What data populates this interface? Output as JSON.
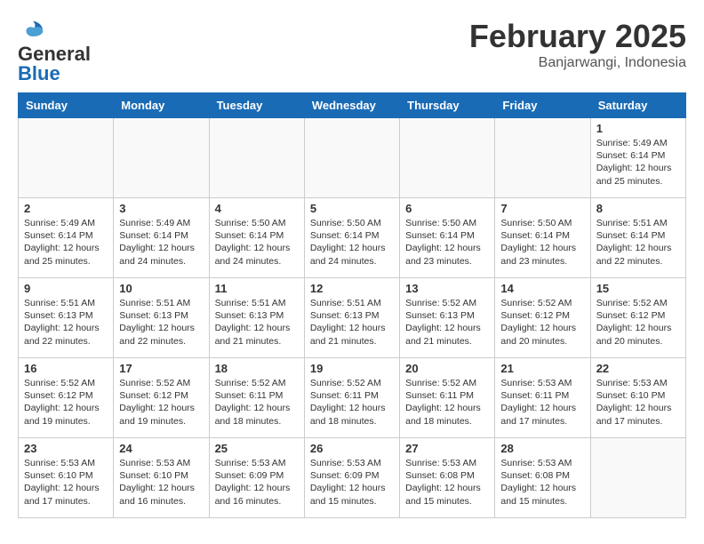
{
  "header": {
    "logo_general": "General",
    "logo_blue": "Blue",
    "month_year": "February 2025",
    "location": "Banjarwangi, Indonesia"
  },
  "days_of_week": [
    "Sunday",
    "Monday",
    "Tuesday",
    "Wednesday",
    "Thursday",
    "Friday",
    "Saturday"
  ],
  "weeks": [
    [
      {
        "day": "",
        "info": ""
      },
      {
        "day": "",
        "info": ""
      },
      {
        "day": "",
        "info": ""
      },
      {
        "day": "",
        "info": ""
      },
      {
        "day": "",
        "info": ""
      },
      {
        "day": "",
        "info": ""
      },
      {
        "day": "1",
        "info": "Sunrise: 5:49 AM\nSunset: 6:14 PM\nDaylight: 12 hours\nand 25 minutes."
      }
    ],
    [
      {
        "day": "2",
        "info": "Sunrise: 5:49 AM\nSunset: 6:14 PM\nDaylight: 12 hours\nand 25 minutes."
      },
      {
        "day": "3",
        "info": "Sunrise: 5:49 AM\nSunset: 6:14 PM\nDaylight: 12 hours\nand 24 minutes."
      },
      {
        "day": "4",
        "info": "Sunrise: 5:50 AM\nSunset: 6:14 PM\nDaylight: 12 hours\nand 24 minutes."
      },
      {
        "day": "5",
        "info": "Sunrise: 5:50 AM\nSunset: 6:14 PM\nDaylight: 12 hours\nand 24 minutes."
      },
      {
        "day": "6",
        "info": "Sunrise: 5:50 AM\nSunset: 6:14 PM\nDaylight: 12 hours\nand 23 minutes."
      },
      {
        "day": "7",
        "info": "Sunrise: 5:50 AM\nSunset: 6:14 PM\nDaylight: 12 hours\nand 23 minutes."
      },
      {
        "day": "8",
        "info": "Sunrise: 5:51 AM\nSunset: 6:14 PM\nDaylight: 12 hours\nand 22 minutes."
      }
    ],
    [
      {
        "day": "9",
        "info": "Sunrise: 5:51 AM\nSunset: 6:13 PM\nDaylight: 12 hours\nand 22 minutes."
      },
      {
        "day": "10",
        "info": "Sunrise: 5:51 AM\nSunset: 6:13 PM\nDaylight: 12 hours\nand 22 minutes."
      },
      {
        "day": "11",
        "info": "Sunrise: 5:51 AM\nSunset: 6:13 PM\nDaylight: 12 hours\nand 21 minutes."
      },
      {
        "day": "12",
        "info": "Sunrise: 5:51 AM\nSunset: 6:13 PM\nDaylight: 12 hours\nand 21 minutes."
      },
      {
        "day": "13",
        "info": "Sunrise: 5:52 AM\nSunset: 6:13 PM\nDaylight: 12 hours\nand 21 minutes."
      },
      {
        "day": "14",
        "info": "Sunrise: 5:52 AM\nSunset: 6:12 PM\nDaylight: 12 hours\nand 20 minutes."
      },
      {
        "day": "15",
        "info": "Sunrise: 5:52 AM\nSunset: 6:12 PM\nDaylight: 12 hours\nand 20 minutes."
      }
    ],
    [
      {
        "day": "16",
        "info": "Sunrise: 5:52 AM\nSunset: 6:12 PM\nDaylight: 12 hours\nand 19 minutes."
      },
      {
        "day": "17",
        "info": "Sunrise: 5:52 AM\nSunset: 6:12 PM\nDaylight: 12 hours\nand 19 minutes."
      },
      {
        "day": "18",
        "info": "Sunrise: 5:52 AM\nSunset: 6:11 PM\nDaylight: 12 hours\nand 18 minutes."
      },
      {
        "day": "19",
        "info": "Sunrise: 5:52 AM\nSunset: 6:11 PM\nDaylight: 12 hours\nand 18 minutes."
      },
      {
        "day": "20",
        "info": "Sunrise: 5:52 AM\nSunset: 6:11 PM\nDaylight: 12 hours\nand 18 minutes."
      },
      {
        "day": "21",
        "info": "Sunrise: 5:53 AM\nSunset: 6:11 PM\nDaylight: 12 hours\nand 17 minutes."
      },
      {
        "day": "22",
        "info": "Sunrise: 5:53 AM\nSunset: 6:10 PM\nDaylight: 12 hours\nand 17 minutes."
      }
    ],
    [
      {
        "day": "23",
        "info": "Sunrise: 5:53 AM\nSunset: 6:10 PM\nDaylight: 12 hours\nand 17 minutes."
      },
      {
        "day": "24",
        "info": "Sunrise: 5:53 AM\nSunset: 6:10 PM\nDaylight: 12 hours\nand 16 minutes."
      },
      {
        "day": "25",
        "info": "Sunrise: 5:53 AM\nSunset: 6:09 PM\nDaylight: 12 hours\nand 16 minutes."
      },
      {
        "day": "26",
        "info": "Sunrise: 5:53 AM\nSunset: 6:09 PM\nDaylight: 12 hours\nand 15 minutes."
      },
      {
        "day": "27",
        "info": "Sunrise: 5:53 AM\nSunset: 6:08 PM\nDaylight: 12 hours\nand 15 minutes."
      },
      {
        "day": "28",
        "info": "Sunrise: 5:53 AM\nSunset: 6:08 PM\nDaylight: 12 hours\nand 15 minutes."
      },
      {
        "day": "",
        "info": ""
      }
    ]
  ]
}
